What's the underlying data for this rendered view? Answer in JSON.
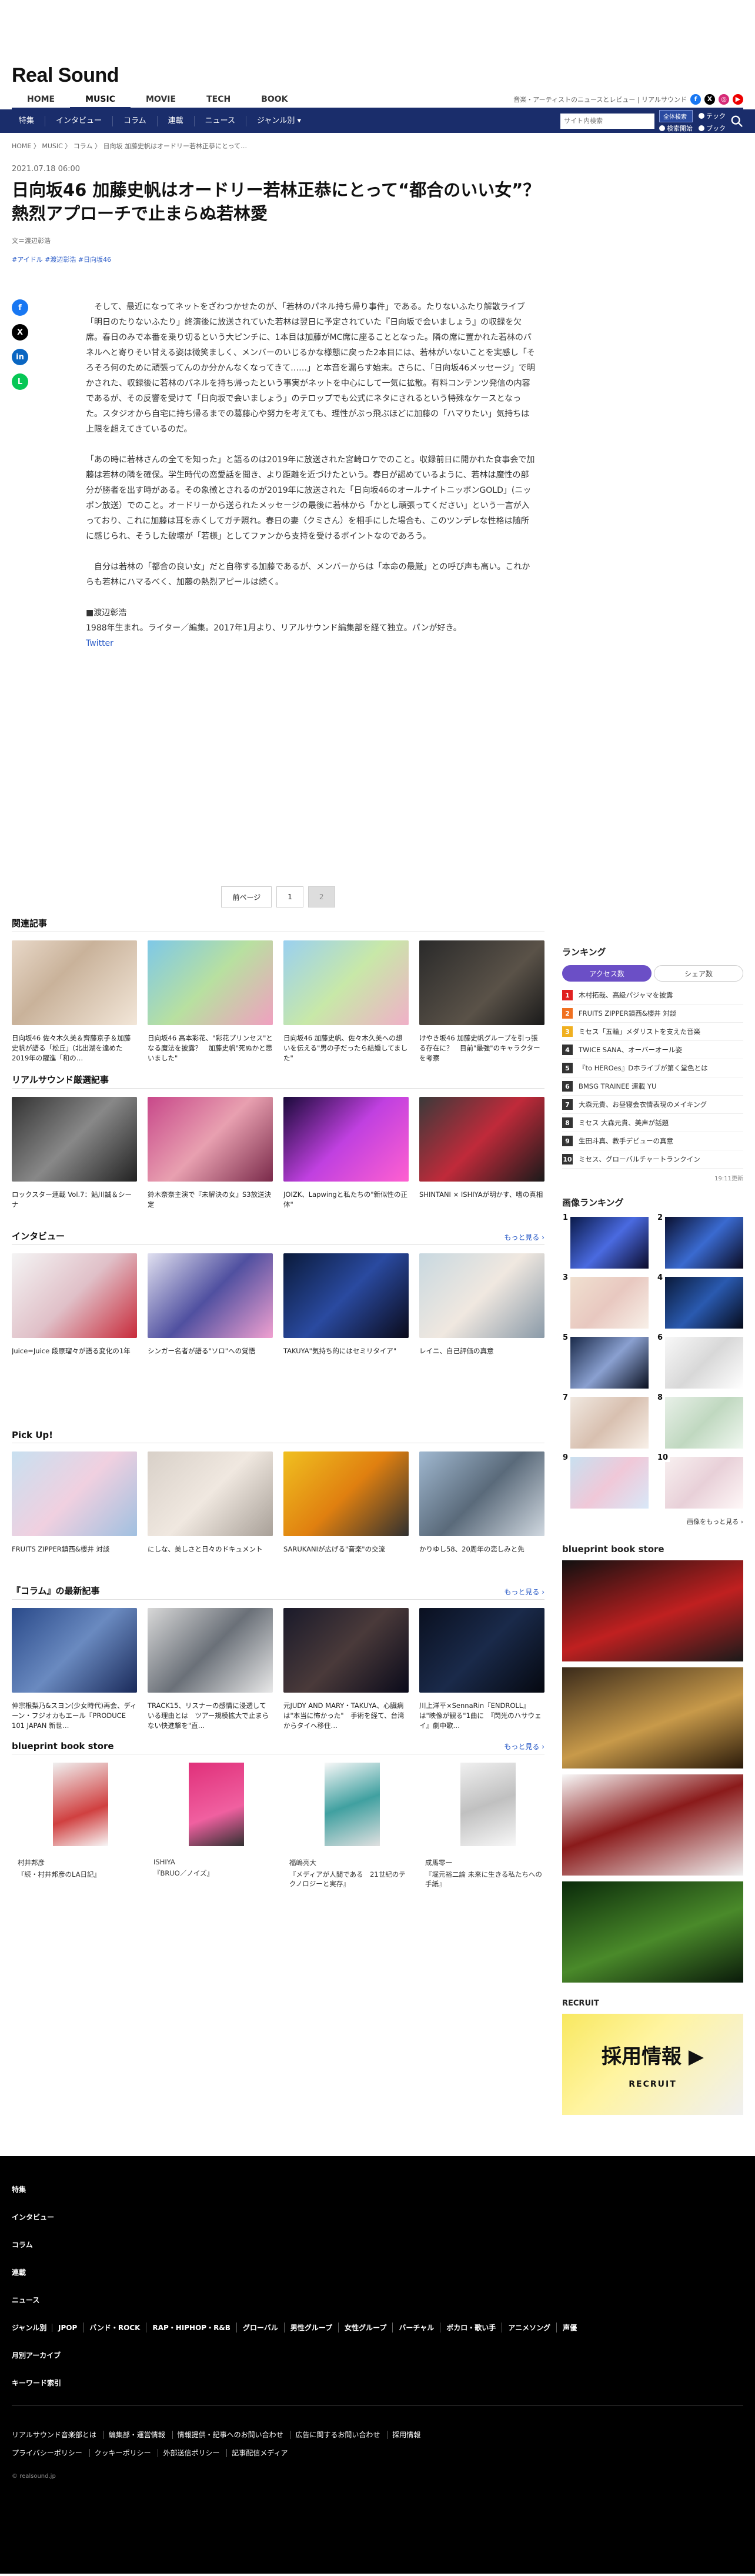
{
  "site": {
    "logo": "Real Sound",
    "tagline": "音楽・アーティストのニュースとレビュー | リアルサウンド"
  },
  "global_nav": [
    "HOME",
    "MUSIC",
    "MOVIE",
    "TECH",
    "BOOK"
  ],
  "sub_nav": [
    "特集",
    "インタビュー",
    "コラム",
    "連載",
    "ニュース",
    "ジャンル別 ▾"
  ],
  "search": {
    "placeholder": "サイト内検索",
    "button": "全体検索",
    "options": [
      "検索開始",
      "ブック",
      "テック"
    ]
  },
  "breadcrumb": "HOME 〉 MUSIC 〉 コラム 〉 日向坂 加藤史帆はオードリー若林正恭にとって…",
  "article": {
    "date": "2021.07.18 06:00",
    "title": "日向坂46 加藤史帆はオードリー若林正恭にとって“都合のいい女”？　熱烈アプローチで止まらぬ若林愛",
    "byline": "文＝渡辺彰浩",
    "tags": "#アイドル #渡辺彰浩 #日向坂46",
    "paragraphs": [
      "　そして、最近になってネットをざわつかせたのが、「若林のパネル持ち帰り事件」である。たりないふたり解散ライブ「明日のたりないふたり」終演後に放送されていた若林は翌日に予定されていた『日向坂で会いましょう』の収録を欠席。春日のみで本番を乗り切るという大ピンチに、1本目は加藤がMC席に座ることとなった。隣の席に置かれた若林のパネルへと寄りそい甘える姿は微笑ましく、メンバーのいじるかな様態に戻った2本目には、若林がいないことを実感し「そろそろ何のために頑張ってんのか分かんなくなってきて……」と本音を漏らす始末。さらに、「日向坂46メッセージ」で明かされた、収録後に若林のパネルを持ち帰ったという事実がネットを中心にして一気に拡散。有料コンテンツ発信の内容であるが、その反響を受けて「日向坂で会いましょう」のテロップでも公式にネタにされるという特殊なケースとなった。スタジオから自宅に持ち帰るまでの葛藤心や努力を考えても、理性がぶっ飛ぶほどに加藤の「ハマりたい」気持ちは上限を超えてきているのだ。",
      "「あの時に若林さんの全てを知った」と語るのは2019年に放送された宮崎ロケでのこと。収録前日に開かれた食事会で加藤は若林の隣を確保。学生時代の恋愛話を聞き、より距離を近づけたという。春日が認めているように、若林は魔性の部分が勝者を出す時がある。その象徴とされるのが2019年に放送された「日向坂46のオールナイトニッポンGOLD」(ニッポン放送）でのこと。オードリーから送られたメッセージの最後に若林から「かとし頑張ってください」という一言が入っており、これに加藤は耳を赤くしてガチ照れ。春日の妻（クミさん）を相手にした場合も、このツンデレな性格は随所に感じられ、そうした破壊が「若様」としてファンから支持を受けるポイントなのであろう。",
      "　自分は若林の「都合の良い女」だと自称する加藤であるが、メンバーからは「本命の最厳」との呼び声も高い。これからも若林にハマるべく、加藤の熱烈アピールは続く。"
    ],
    "author_label": "■渡辺彰浩",
    "author_bio": "1988年生まれ。ライター／編集。2017年1月より、リアルサウンド編集部を経て独立。パンが好き。",
    "author_link": "Twitter"
  },
  "share_icons": [
    "facebook-icon",
    "x-icon",
    "linkedin-icon",
    "line-icon"
  ],
  "pager": {
    "prev": "前ページ",
    "p1": "1",
    "p2": "2"
  },
  "related": {
    "heading": "関連記事",
    "items": [
      "日向坂46 佐々木久美＆齊藤京子＆加藤史帆が語る「松丘」(北出湖を達めた2019年の躍進「和の…",
      "日向坂46 高本彩花、\"彩花プリンセス\"となる魔法を披露？　加藤史帆\"死ぬかと思いました\"",
      "日向坂46 加藤史帆、佐々木久美への想いを伝える\"男の子だったら結婚してました\"",
      "けやき坂46 加藤史帆グループを引っ張る存在に？　目前\"最強\"のキャラクターを考察"
    ]
  },
  "picked": {
    "heading": "リアルサウンド厳選記事",
    "items": [
      "ロックスター連載 Vol.7：鮎川誠＆シーナ",
      "鈴木奈奈主演で『未解決の女』S3放送決定",
      "JOIZK、Lapwingと私たちの\"新似性の正体\"",
      "SHINTANI × ISHIYAが明かす、嗜の真相"
    ]
  },
  "interview": {
    "heading": "インタビュー",
    "more": "もっと見る ›",
    "items": [
      "Juice=Juice 段原瑠々が語る変化の1年",
      "シンガー名者が語る\"ソロ\"への覚悟",
      "TAKUYA\"気持ち的にはセミリタイア\"",
      "レイニ、自己評価の真意"
    ]
  },
  "pickup": {
    "heading": "Pick Up!",
    "items": [
      "FRUITS ZIPPER鎮西&櫻井 対談",
      "にしな、美しさと日々のドキュメント",
      "SARUKANIが広げる\"音楽\"の交流",
      "かりゆし58、20周年の恋しみと先"
    ]
  },
  "column": {
    "heading": "『コラム』の最新記事",
    "more": "もっと見る ›",
    "items": [
      "仲宗根梨乃&スヨン(少女時代)再会、ディーン・フジオカもエール『PRODUCE 101 JAPAN 新世…",
      "TRACK15、リスナーの感情に浸透している理由とは　ツアー規模拡大で止まらない快進撃を\"直…",
      "元JUDY AND MARY・TAKUYA、心臓病は\"本当に怖かった\"　手術を経て、台湾からタイへ移住…",
      "川上洋平×SennaRin『ENDROLL』は\"映像が観る\"1曲に　『閃光のハサウェイ』劇中歌…"
    ]
  },
  "book_store": {
    "heading": "blueprint book store",
    "more": "もっと見る ›",
    "items": [
      {
        "author": "村井邦彦",
        "title": "『続・村井邦彦のLA日記』"
      },
      {
        "author": "ISHIYA",
        "title": "『BRUO／ノイズ』"
      },
      {
        "author": "福嶋亮大",
        "title": "『メディアが人間である　21世紀のテクノロジーと実存』"
      },
      {
        "author": "成馬零一",
        "title": "『堀元裕二論 未来に生きる私たちへの手紙』"
      }
    ]
  },
  "ranking": {
    "heading": "ランキング",
    "tabs": [
      "アクセス数",
      "シェア数"
    ],
    "items": [
      "木村拓哉、高級パジャマを披露",
      "FRUITS ZIPPER鎮西&櫻井 対談",
      "ミセス「五輪」メダリストを支えた音楽",
      "TWICE SANA、オーバーオール姿",
      "『to HEROes』Dホライブが第く堂色とは",
      "BMSG TRAINEE 連載 YU",
      "大森元貴、お昼寝会衣情表現のメイキング",
      "ミセス 大森元貴、美声が話題",
      "生田斗真、教手デビューの真意",
      "ミセス、グローバルチャートランクイン"
    ],
    "updated": "19:11更新"
  },
  "image_ranking": {
    "heading": "画像ランキング",
    "more": "画像をもっと見る ›",
    "nums": [
      "1",
      "2",
      "3",
      "4",
      "5",
      "6",
      "7",
      "8",
      "9",
      "10"
    ]
  },
  "side_book": {
    "heading": "blueprint book store"
  },
  "recruit": {
    "heading": "RECRUIT",
    "banner": "採用情報 ▶",
    "brand": "RECRUIT"
  },
  "footer": {
    "items": [
      "特集",
      "インタビュー",
      "コラム",
      "連載",
      "ニュース"
    ],
    "genre_label": "ジャンル別",
    "genres": [
      "JPOP",
      "バンド・ROCK",
      "RAP・HIPHOP・R&B",
      "グローバル",
      "男性グループ",
      "女性グループ",
      "バーチャル",
      "ボカロ・歌い手",
      "アニメソング",
      "声優"
    ],
    "items2": [
      "月別アーカイブ",
      "キーワード索引"
    ],
    "links": [
      "リアルサウンド音楽部とは",
      "編集部・運営情報",
      "情報提供・記事へのお問い合わせ",
      "広告に関するお問い合わせ",
      "採用情報"
    ],
    "links2": [
      "プライバシーポリシー",
      "クッキーポリシー",
      "外部送信ポリシー",
      "記事配信メディア"
    ],
    "copyright": "© realsound.jp"
  },
  "colors": {
    "brand": "#1a2d6b",
    "accent": "#6b4fc6",
    "link": "#2a5bc7"
  }
}
